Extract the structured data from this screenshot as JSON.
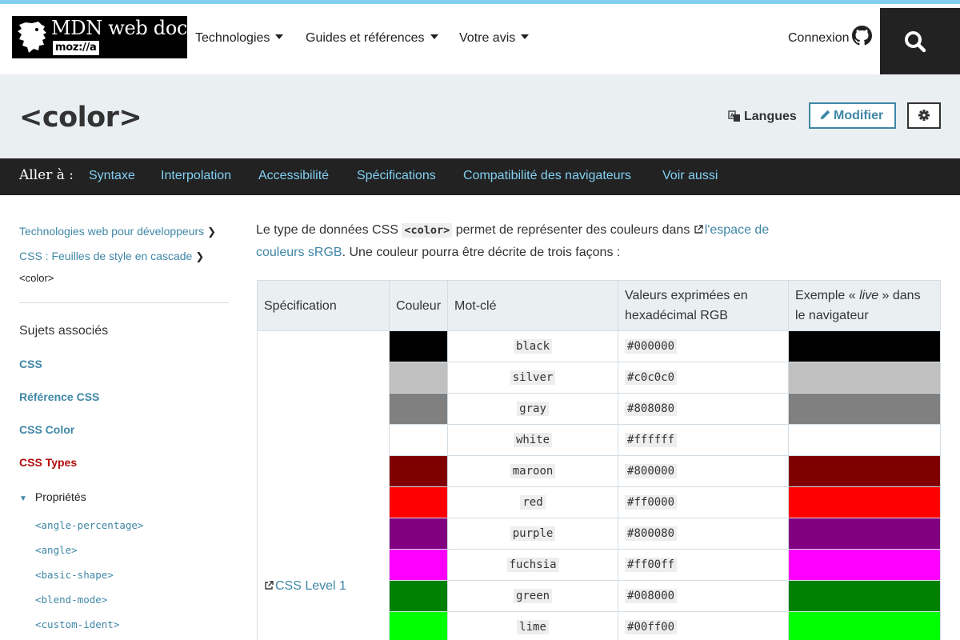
{
  "header": {
    "logo_text": "MDN web docs",
    "logo_sub": "moz://a",
    "nav": [
      "Technologies",
      "Guides et références",
      "Votre avis"
    ],
    "signin_label": "Connexion"
  },
  "title_bar": {
    "title": "<color>",
    "languages_label": "Langues",
    "edit_label": "Modifier"
  },
  "jump": {
    "label": "Aller à :",
    "links": [
      "Syntaxe",
      "Interpolation",
      "Accessibilité",
      "Spécifications",
      "Compatibilité des navigateurs",
      "Voir aussi"
    ]
  },
  "sidebar": {
    "breadcrumbs": [
      "Technologies web pour développeurs",
      "CSS : Feuilles de style en cascade"
    ],
    "current": "<color>",
    "related_heading": "Sujets associés",
    "links": [
      "CSS",
      "Référence CSS",
      "CSS Color",
      "CSS Types"
    ],
    "tree_toggle": "Propriétés",
    "types": [
      "<angle-percentage>",
      "<angle>",
      "<basic-shape>",
      "<blend-mode>",
      "<custom-ident>"
    ]
  },
  "intro": {
    "before": "Le type de données CSS ",
    "code": "<color>",
    "middle": " permet de représenter des couleurs dans ",
    "link": "l'espace de couleurs sRGB",
    "after": ". Une couleur pourra être décrite de trois façons :"
  },
  "table": {
    "headers": [
      "Spécification",
      "Couleur",
      "Mot-clé",
      "Valeurs exprimées en hexadécimal RGB"
    ],
    "header_live_before": "Exemple « ",
    "header_live_em": "live",
    "header_live_after": " » dans le navigateur",
    "spec": "CSS Level 1",
    "rows": [
      {
        "keyword": "black",
        "hex": "#000000",
        "color": "#000000"
      },
      {
        "keyword": "silver",
        "hex": "#c0c0c0",
        "color": "#c0c0c0"
      },
      {
        "keyword": "gray",
        "hex": "#808080",
        "color": "#808080"
      },
      {
        "keyword": "white",
        "hex": "#ffffff",
        "color": "#ffffff"
      },
      {
        "keyword": "maroon",
        "hex": "#800000",
        "color": "#800000"
      },
      {
        "keyword": "red",
        "hex": "#ff0000",
        "color": "#ff0000"
      },
      {
        "keyword": "purple",
        "hex": "#800080",
        "color": "#800080"
      },
      {
        "keyword": "fuchsia",
        "hex": "#ff00ff",
        "color": "#ff00ff"
      },
      {
        "keyword": "green",
        "hex": "#008000",
        "color": "#008000"
      },
      {
        "keyword": "lime",
        "hex": "#00ff00",
        "color": "#00ff00"
      }
    ]
  },
  "colors": {
    "accent_link": "#3f87a6",
    "jump_link": "#83d0f2",
    "active_link": "#b30b0b",
    "dark_bar": "#222222",
    "title_bg": "#eaeff2"
  }
}
